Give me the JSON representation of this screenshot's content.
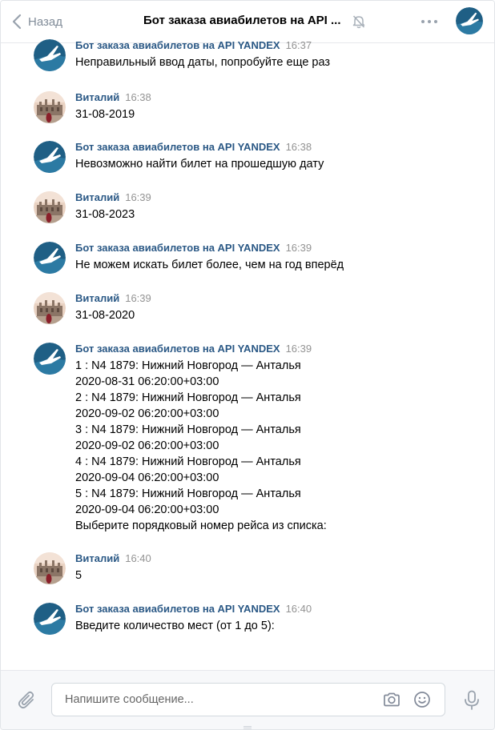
{
  "header": {
    "back_label": "Назад",
    "title": "Бот заказа авиабилетов на API ..."
  },
  "messages": [
    {
      "author": "Бот заказа авиабилетов на API YANDEX",
      "time": "16:37",
      "lines": [
        "Неправильный ввод даты, попробуйте еще раз"
      ]
    },
    {
      "author": "Виталий",
      "time": "16:38",
      "lines": [
        "31-08-2019"
      ]
    },
    {
      "author": "Бот заказа авиабилетов на API YANDEX",
      "time": "16:38",
      "lines": [
        "Невозможно найти билет на прошедшую дату"
      ]
    },
    {
      "author": "Виталий",
      "time": "16:39",
      "lines": [
        "31-08-2023"
      ]
    },
    {
      "author": "Бот заказа авиабилетов на API YANDEX",
      "time": "16:39",
      "lines": [
        "Не можем искать билет более, чем на год вперёд"
      ]
    },
    {
      "author": "Виталий",
      "time": "16:39",
      "lines": [
        "31-08-2020"
      ]
    },
    {
      "author": "Бот заказа авиабилетов на API YANDEX",
      "time": "16:39",
      "lines": [
        "1 : N4 1879: Нижний Новгород — Анталья",
        "2020-08-31 06:20:00+03:00",
        "2 : N4 1879: Нижний Новгород — Анталья",
        "2020-09-02 06:20:00+03:00",
        "3 : N4 1879: Нижний Новгород — Анталья",
        "2020-09-02 06:20:00+03:00",
        "4 : N4 1879: Нижний Новгород — Анталья",
        "2020-09-04 06:20:00+03:00",
        "5 : N4 1879: Нижний Новгород — Анталья",
        "2020-09-04 06:20:00+03:00",
        "Выберите порядковый номер рейса из списка:"
      ]
    },
    {
      "author": "Виталий",
      "time": "16:40",
      "lines": [
        "5"
      ]
    },
    {
      "author": "Бот заказа авиабилетов на API YANDEX",
      "time": "16:40",
      "lines": [
        "Введите количество мест (от 1 до 5):"
      ]
    }
  ],
  "composer": {
    "placeholder": "Напишите сообщение..."
  },
  "icons": {
    "back": "chevron-left-icon",
    "mute": "muted-bell-icon",
    "more": "more-dots-icon",
    "attach": "paperclip-icon",
    "camera": "camera-icon",
    "emoji": "smile-icon",
    "voice": "microphone-icon"
  },
  "colors": {
    "author": "#2a5885",
    "muted_text": "#818c99",
    "time": "#939393",
    "composer_bg": "#f7f8fa"
  }
}
